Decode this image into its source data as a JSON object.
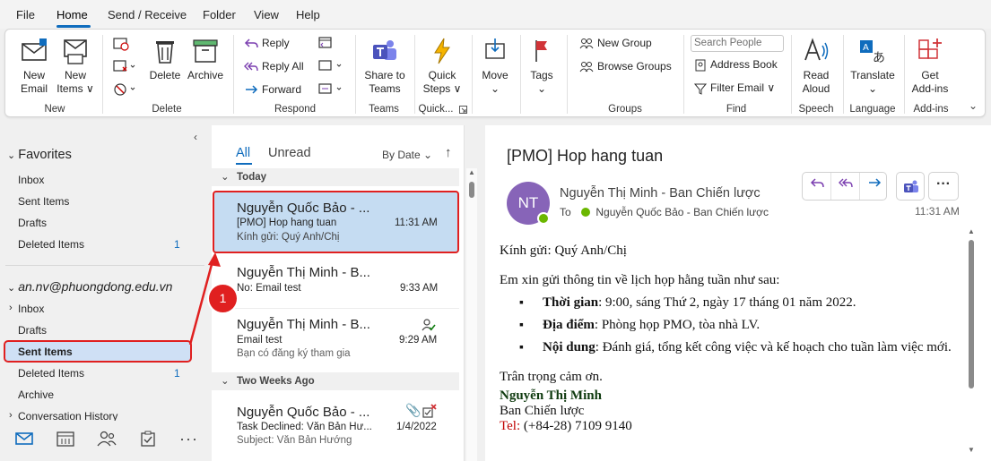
{
  "menu": [
    "File",
    "Home",
    "Send / Receive",
    "Folder",
    "View",
    "Help"
  ],
  "ribbon": {
    "new_group": {
      "label": "New",
      "new_email": [
        "New",
        "Email"
      ],
      "new_items": [
        "New",
        "Items ∨"
      ]
    },
    "delete_group": {
      "label": "Delete",
      "delete": "Delete",
      "archive": "Archive"
    },
    "respond_group": {
      "label": "Respond",
      "reply": "Reply",
      "reply_all": "Reply All",
      "forward": "Forward"
    },
    "teams_group": {
      "label": "Teams",
      "share": [
        "Share to",
        "Teams"
      ]
    },
    "quick_group": {
      "label": "Quick...",
      "quick_steps": [
        "Quick",
        "Steps ∨"
      ]
    },
    "move": "Move",
    "tags": "Tags",
    "groups_group": {
      "label": "Groups",
      "new_group": "New Group",
      "browse_groups": "Browse Groups"
    },
    "find_group": {
      "label": "Find",
      "search_people": "Search People",
      "address_book": "Address Book",
      "filter_email": "Filter Email ∨"
    },
    "speech_group": {
      "label": "Speech",
      "read_aloud": [
        "Read",
        "Aloud"
      ]
    },
    "language_group": {
      "label": "Language",
      "translate": "Translate"
    },
    "addins_group": {
      "label": "Add-ins",
      "get_addins": [
        "Get",
        "Add-ins"
      ]
    }
  },
  "nav": {
    "favorites": "Favorites",
    "fav_items": [
      {
        "label": "Inbox"
      },
      {
        "label": "Sent Items"
      },
      {
        "label": "Drafts"
      },
      {
        "label": "Deleted Items",
        "count": "1"
      }
    ],
    "account": "an.nv@phuongdong.edu.vn",
    "acc_items": [
      {
        "label": "Inbox"
      },
      {
        "label": "Drafts"
      },
      {
        "label": "Sent Items"
      },
      {
        "label": "Deleted Items",
        "count": "1"
      },
      {
        "label": "Archive"
      },
      {
        "label": "Conversation History"
      }
    ]
  },
  "list": {
    "tab_all": "All",
    "tab_unread": "Unread",
    "sort": "By Date",
    "group_today": "Today",
    "group_two_weeks": "Two Weeks Ago",
    "messages": [
      {
        "sender": "Nguyễn Quốc Bảo - ...",
        "subject": "[PMO] Hop hang tuan",
        "time": "11:31 AM",
        "preview": "Kính gửi: Quý Anh/Chị"
      },
      {
        "sender": "Nguyễn Thị Minh - B...",
        "subject": "No: Email test",
        "time": "9:33 AM",
        "preview": ""
      },
      {
        "sender": "Nguyễn Thị Minh - B...",
        "subject": "Email test",
        "time": "9:29 AM",
        "preview": "Bạn có đăng ký tham gia"
      },
      {
        "sender": "Nguyễn Quốc Bảo - ...",
        "subject": "Task Declined: Văn Bản Hư...",
        "time": "1/4/2022",
        "preview": "Subject:  Văn Bản Hướng"
      }
    ]
  },
  "reader": {
    "subject": "[PMO] Hop hang tuan",
    "avatar_initials": "NT",
    "from": "Nguyễn Thị Minh - Ban Chiến lược",
    "to_label": "To",
    "to": "Nguyễn Quốc Bảo - Ban Chiến lược",
    "time": "11:31 AM",
    "greeting": "Kính gửi: Quý Anh/Chị",
    "intro": "Em xin gửi thông tin về lịch họp hằng tuần như sau:",
    "bullets": [
      {
        "key": "Thời gian",
        "text": ": 9:00, sáng Thứ 2, ngày 17 tháng 01 năm 2022."
      },
      {
        "key": "Địa điểm",
        "text": ": Phòng họp PMO, tòa nhà LV."
      },
      {
        "key": "Nội dung",
        "text": ": Đánh giá, tổng kết công việc và kế hoạch cho tuần làm việc mới."
      }
    ],
    "closing": "Trân trọng cảm ơn.",
    "sig_name": "Nguyễn Thị Minh",
    "sig_dept": "Ban Chiến lược",
    "sig_tel_label": "Tel:",
    "sig_tel": " (+84-28) 7109 9140"
  },
  "annotation": "1",
  "colors": {
    "accent": "#0f6cbd",
    "highlight": "#e02020",
    "avatar": "#8764b8",
    "selected": "#c5dcf2"
  }
}
